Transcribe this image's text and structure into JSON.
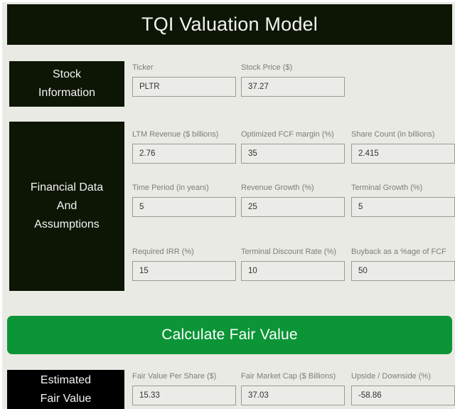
{
  "header": {
    "title": "TQI Valuation Model",
    "background": "#0d1505",
    "text_color": "#f2f3f0"
  },
  "theme": {
    "page_background": "#eaeae5",
    "panel_dark": "#0d1505",
    "panel_black": "#000000",
    "accent_green": "#0b9537",
    "input_background": "#ebebe8",
    "input_border": "#9a9a96",
    "label_color": "#7d7d79"
  },
  "sections": {
    "stock": {
      "panel_label": "Stock\nInformation",
      "panel_label_line1": "Stock",
      "panel_label_line2": "Information",
      "fields": [
        {
          "label": "Ticker",
          "value": "PLTR",
          "placeholder": "Ticker"
        },
        {
          "label": "Stock Price ($)",
          "value": "37.27",
          "placeholder": "Stock Price ($)"
        }
      ]
    },
    "financial": {
      "panel_label_line1": "Financial Data",
      "panel_label_line2": "And",
      "panel_label_line3": "Assumptions",
      "fields": [
        {
          "label": "LTM Revenue ($ billions)",
          "value": "2.76",
          "placeholder": "LTM Revenue ($ billions)"
        },
        {
          "label": "Optimized FCF margin (%)",
          "value": "35",
          "placeholder": "Optimized FCF margin (%)"
        },
        {
          "label": "Share Count (in billions)",
          "value": "2.415",
          "placeholder": "Share Count (in billions)"
        },
        {
          "label": "Time Period (in years)",
          "value": "5",
          "placeholder": "Time Period (in years)"
        },
        {
          "label": "Revenue Growth (%)",
          "value": "25",
          "placeholder": "Revenue Growth (%)"
        },
        {
          "label": "Terminal Growth (%)",
          "value": "5",
          "placeholder": "Terminal Growth (%)"
        },
        {
          "label": "Required IRR (%)",
          "value": "15",
          "placeholder": "Required IRR (%)"
        },
        {
          "label": "Terminal Discount Rate (%)",
          "value": "10",
          "placeholder": "Terminal Discount Rate (%)"
        },
        {
          "label": "Buyback as a %age of FCF",
          "value": "50",
          "placeholder": "Buyback as a %age of FCF"
        }
      ]
    },
    "estimated": {
      "panel_label_line1": "Estimated",
      "panel_label_line2": "Fair Value",
      "fields": [
        {
          "label": "Fair Value Per Share ($)",
          "value": "15.33",
          "placeholder": "Fair Value Per Share ($)"
        },
        {
          "label": "Fair Market Cap ($ Billions)",
          "value": "37.03",
          "placeholder": "Fair Market Cap ($ Billions)"
        },
        {
          "label": "Upside / Downside (%)",
          "value": "-58.86",
          "placeholder": "Upside / Downside (%)"
        }
      ]
    }
  },
  "calculate_button": {
    "label": "Calculate Fair Value"
  }
}
